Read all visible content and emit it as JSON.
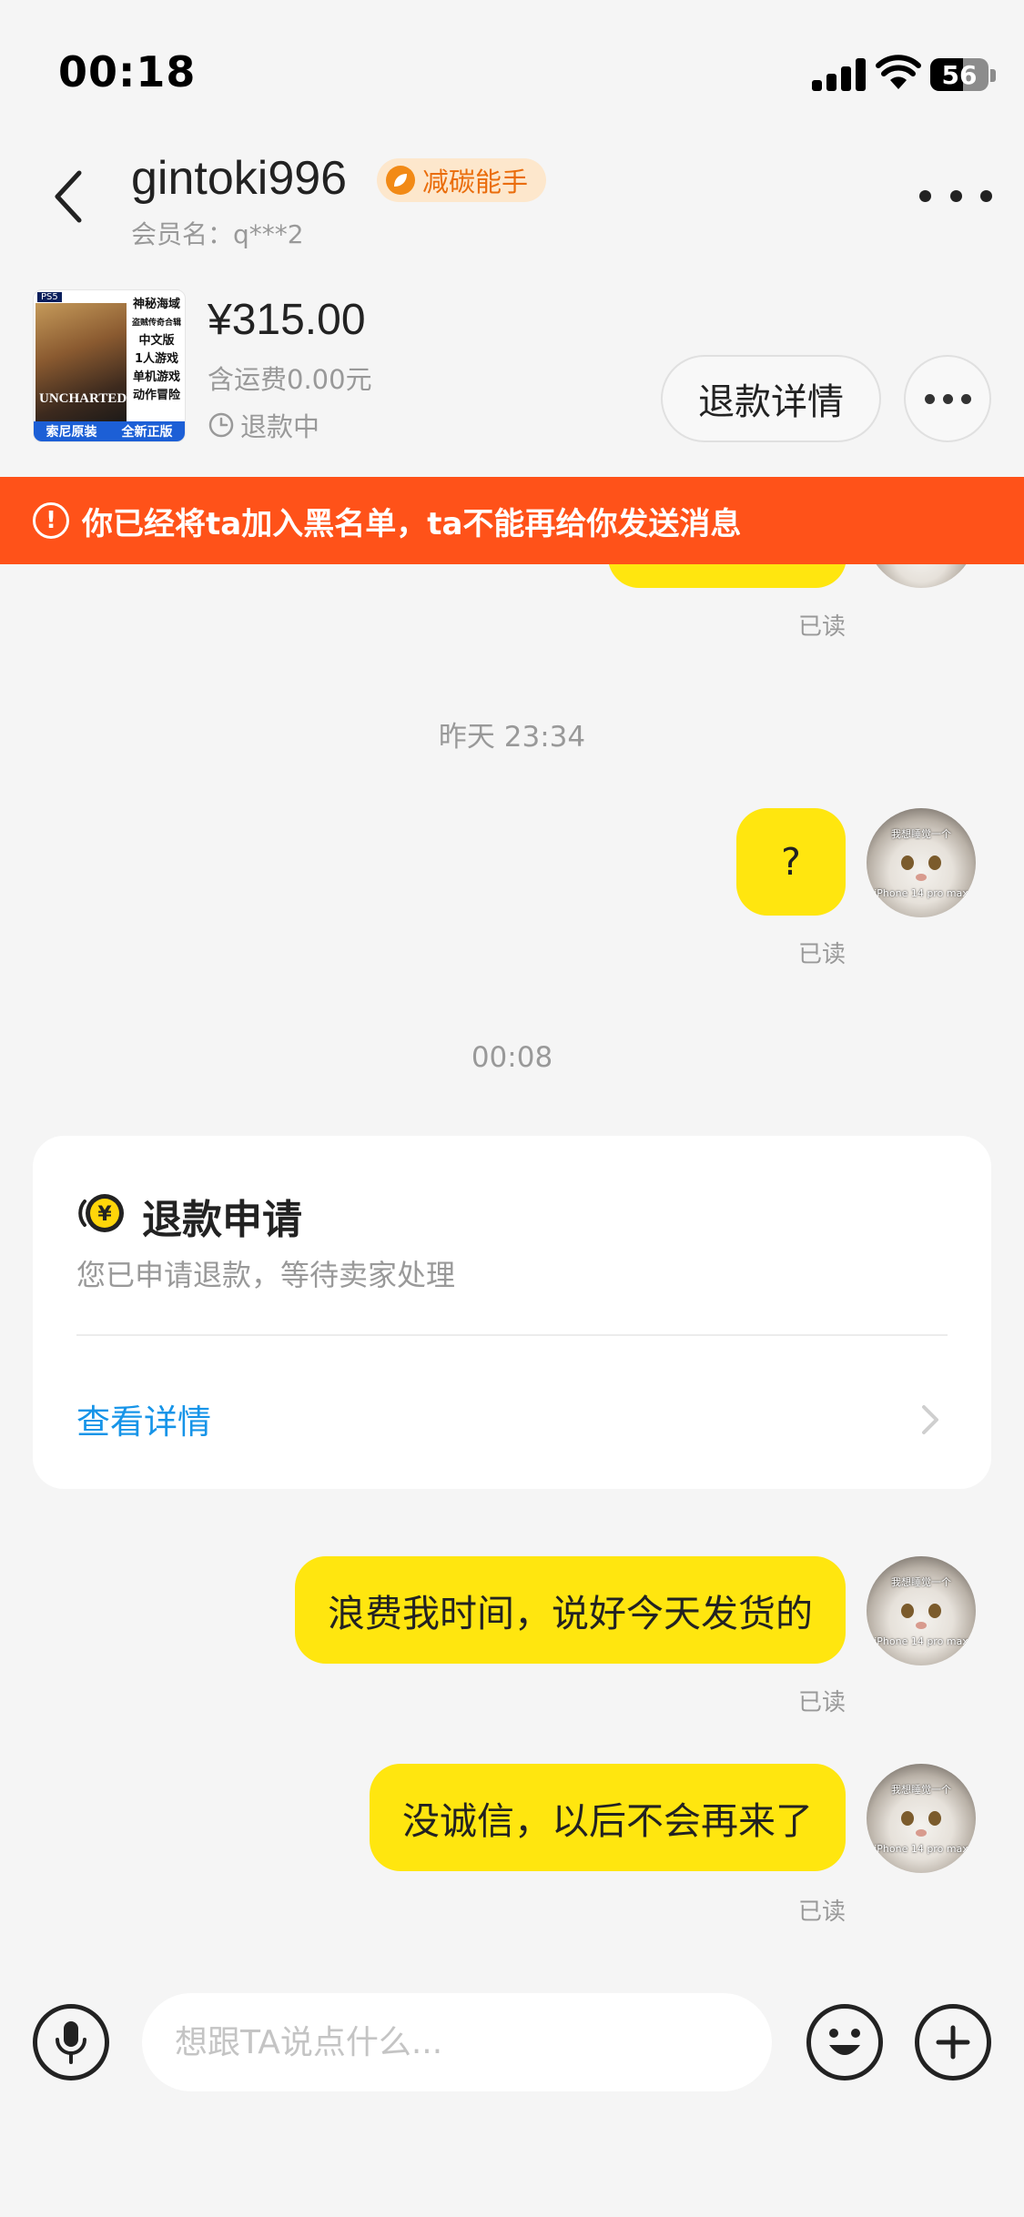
{
  "status_bar": {
    "time": "00:18",
    "battery": "56",
    "battery_level_percent": 56
  },
  "header": {
    "username": "gintoki996",
    "badge": "减碳能手",
    "member_label": "会员名：q***2",
    "icons": {
      "back": "chevron-left-icon",
      "more": "more-horizontal-icon",
      "badge": "leaf-icon"
    }
  },
  "product": {
    "thumbnail": {
      "platform": "PS5",
      "art_title": "UNCHARTED",
      "lines": [
        "神秘海域",
        "盗贼传奇合辑",
        "中文版",
        "1人游戏",
        "单机游戏",
        "动作冒险"
      ],
      "footer_left": "索尼原装",
      "footer_right": "全新正版"
    },
    "price": "¥315.00",
    "shipping": "含运费0.00元",
    "status": "退款中",
    "refund_detail_button": "退款详情"
  },
  "banner": {
    "text": "你已经将ta加入黑名单，ta不能再给你发送消息",
    "color": "#ff5219"
  },
  "chat": {
    "read_label": "已读",
    "timestamps": [
      "昨天 23:34",
      "00:08"
    ],
    "messages": [
      {
        "text": "?",
        "from": "me",
        "status": "已读"
      },
      {
        "text": "浪费我时间，说好今天发货的",
        "from": "me",
        "status": "已读"
      },
      {
        "text": "没诚信，以后不会再来了",
        "from": "me",
        "status": "已读"
      }
    ],
    "avatar_caption_top": "我想睡觉一个",
    "avatar_caption_bottom": "iPhone 14 pro max",
    "bubble_color": "#ffe60f"
  },
  "refund_card": {
    "title": "退款申请",
    "subtitle": "您已申请退款，等待卖家处理",
    "link": "查看详情",
    "link_color": "#1694e8"
  },
  "input_bar": {
    "placeholder": "想跟TA说点什么...",
    "icons": {
      "voice": "microphone-icon",
      "emoji": "smile-icon",
      "add": "plus-icon"
    }
  }
}
